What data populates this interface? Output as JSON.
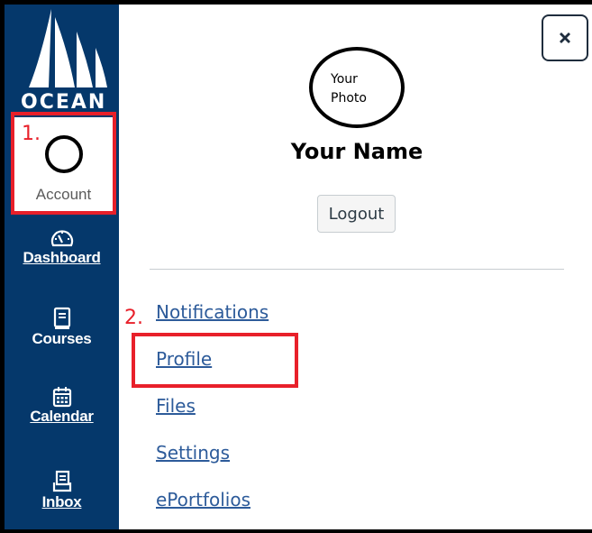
{
  "sidebar": {
    "logo_text": "OCEAN",
    "account_label": "Account",
    "items": [
      {
        "label": "Dashboard",
        "icon": "dashboard-gauge-icon"
      },
      {
        "label": "Courses",
        "icon": "courses-book-icon"
      },
      {
        "label": "Calendar",
        "icon": "calendar-icon"
      },
      {
        "label": "Inbox",
        "icon": "inbox-icon"
      }
    ]
  },
  "annotations": {
    "step1": "1.",
    "step2": "2."
  },
  "tray": {
    "photo_line1": "Your",
    "photo_line2": "Photo",
    "user_name": "Your Name",
    "logout_label": "Logout",
    "close_icon": "close-icon",
    "links": [
      "Notifications",
      "Profile",
      "Files",
      "Settings",
      "ePortfolios"
    ]
  },
  "colors": {
    "sidebar_bg": "#05386b",
    "annotation_red": "#e8202a",
    "link": "#2d5b9a"
  }
}
